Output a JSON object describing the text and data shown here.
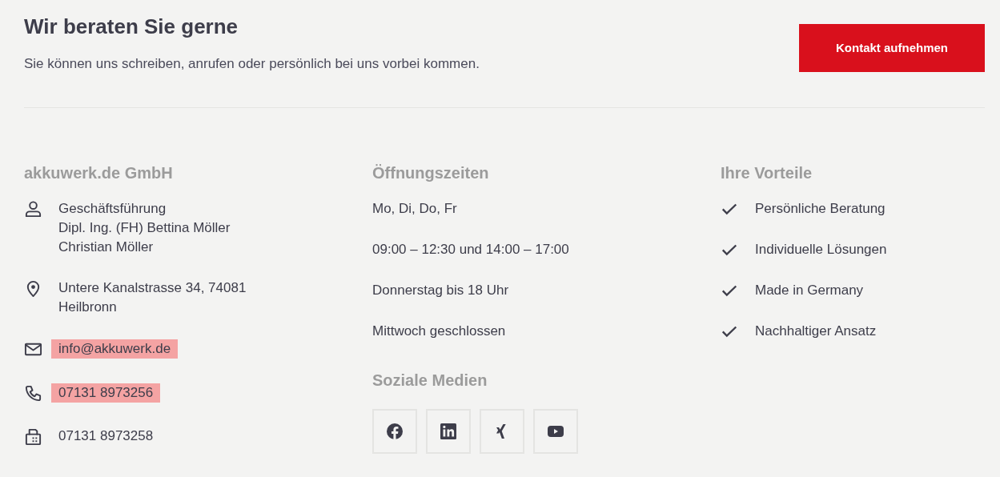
{
  "intro": {
    "title": "Wir beraten Sie gerne",
    "text": "Sie können uns schreiben, anrufen oder persönlich bei uns vorbei kommen.",
    "button": "Kontakt aufnehmen"
  },
  "company": {
    "heading": "akkuwerk.de GmbH",
    "contacts": [
      {
        "kind": "person",
        "lines": [
          "Geschäftsführung",
          "Dipl. Ing. (FH) Bettina Möller",
          "Christian Möller"
        ],
        "highlighted": false
      },
      {
        "kind": "location",
        "lines": [
          "Untere Kanalstrasse 34, 74081",
          "Heilbronn"
        ],
        "highlighted": false
      },
      {
        "kind": "mail",
        "lines": [
          "info@akkuwerk.de"
        ],
        "highlighted": true
      },
      {
        "kind": "phone",
        "lines": [
          "07131 8973256"
        ],
        "highlighted": true
      },
      {
        "kind": "fax",
        "lines": [
          "07131 8973258"
        ],
        "highlighted": false
      }
    ]
  },
  "hours": {
    "heading": "Öffnungszeiten",
    "lines": [
      "Mo, Di, Do, Fr",
      "09:00 – 12:30 und 14:00 – 17:00",
      "Donnerstag bis 18 Uhr",
      "Mittwoch geschlossen"
    ]
  },
  "social": {
    "heading": "Soziale Medien",
    "links": [
      {
        "kind": "facebook"
      },
      {
        "kind": "linkedin"
      },
      {
        "kind": "xing"
      },
      {
        "kind": "youtube"
      }
    ]
  },
  "benefits": {
    "heading": "Ihre Vorteile",
    "items": [
      "Persönliche Beratung",
      "Individuelle Lösungen",
      "Made in Germany",
      "Nachhaltiger Ansatz"
    ]
  }
}
